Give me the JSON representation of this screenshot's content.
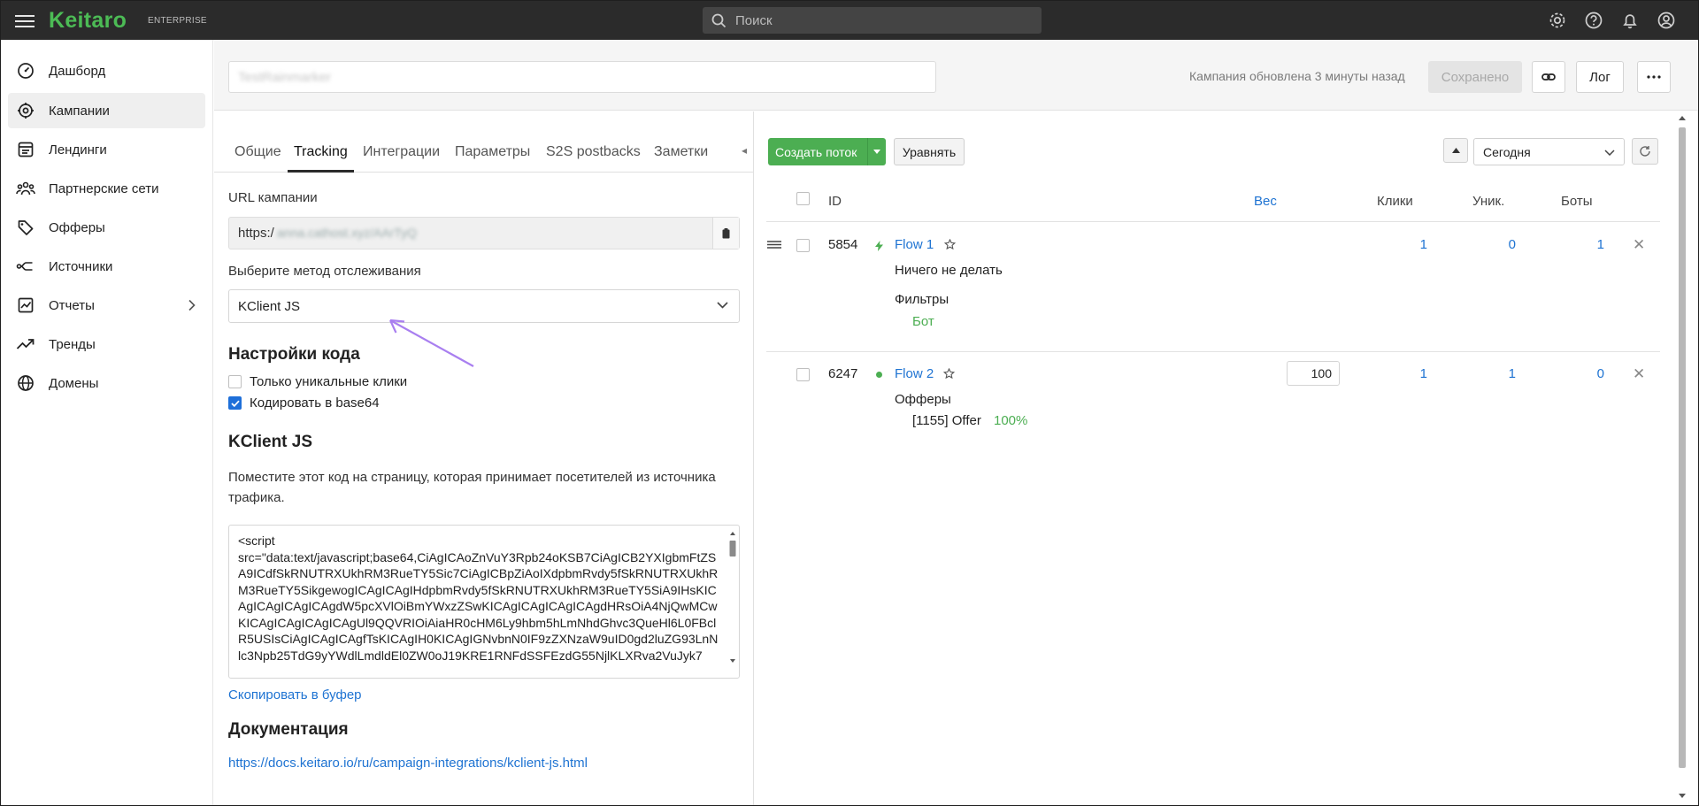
{
  "app": {
    "brand": "Keitaro",
    "edition": "ENTERPRISE",
    "search_placeholder": "Поиск",
    "icons": [
      "menu-icon",
      "search-icon",
      "settings-icon",
      "help-icon",
      "bell-icon",
      "user-icon"
    ]
  },
  "sidebar": {
    "items": [
      {
        "label": "Дашборд",
        "icon": "dashboard-icon"
      },
      {
        "label": "Кампании",
        "icon": "campaigns-icon",
        "active": true
      },
      {
        "label": "Лендинги",
        "icon": "landings-icon"
      },
      {
        "label": "Партнерские сети",
        "icon": "partners-icon"
      },
      {
        "label": "Офферы",
        "icon": "offers-icon"
      },
      {
        "label": "Источники",
        "icon": "sources-icon"
      },
      {
        "label": "Отчеты",
        "icon": "reports-icon"
      },
      {
        "label": "Тренды",
        "icon": "trends-icon"
      },
      {
        "label": "Домены",
        "icon": "domains-icon"
      }
    ]
  },
  "header": {
    "campaign_name": "TestRainmarker",
    "updated_text": "Кампания обновлена 3 минуты назад",
    "saved_label": "Сохранено",
    "log_label": "Лог"
  },
  "left": {
    "tabs": [
      "Общие",
      "Tracking",
      "Интеграции",
      "Параметры",
      "S2S postbacks",
      "Заметки"
    ],
    "active_tab": "Tracking",
    "url_label": "URL кампании",
    "url_prefix": "https:/",
    "url_rest": "anna.cathost.xyz/AArTyQ",
    "method_label": "Выберите метод отслеживания",
    "method_value": "KClient JS",
    "code_settings_title": "Настройки кода",
    "unique_clicks_label": "Только уникальные клики",
    "base64_label": "Кодировать в base64",
    "kclient_title": "KClient JS",
    "kclient_desc": "Поместите этот код на страницу, которая принимает посетителей из источника трафика.",
    "code": "<script\nsrc=\"data:text/javascript;base64,CiAgICAoZnVuY3Rpb24oKSB7CiAgICB2YXIgbmFtZSA9ICdfSkRNUTRXUkhRM3RueTY5Sic7CiAgICBpZiAoIXdpbmRvdy5fSkRNUTRXUkhRM3RueTY5SikgewogICAgICAgIHdpbmRvdy5fSkRNUTRXUkhRM3RueTY5SiA9IHsKICAgICAgICAgICAgdW5pcXVlOiBmYWxzZSwKICAgICAgICAgICAgdHRsOiA4NjQwMCwKICAgICAgICAgICAgUl9QQVRIOiAiaHR0cHM6Ly9hbm5hLmNhdGhvc3QueHl6L0FBclR5USIsCiAgICAgICAgfTsKICAgIH0KICAgIGNvbnN0IF9zZXNzaW9uID0gd2luZG93LnNlc3Npb25TdG9yYWdlLmdldEl0ZW0oJ19KRE1RNFdSSFEzdG55NjlKLXRva2VuJyk7",
    "copy_label": "Скопировать в буфер",
    "docs_title": "Документация",
    "docs_link": "https://docs.keitaro.io/ru/campaign-integrations/kclient-js.html"
  },
  "right": {
    "create_flow_label": "Создать поток",
    "align_label": "Уравнять",
    "date_value": "Сегодня",
    "columns": {
      "id": "ID",
      "weight": "Вес",
      "clicks": "Клики",
      "unique": "Уник.",
      "bots": "Боты"
    },
    "flows": [
      {
        "id": "5854",
        "name": "Flow 1",
        "action": "Ничего не делать",
        "section": "Фильтры",
        "detail": "Бот",
        "weight": "",
        "clicks": "1",
        "unique": "0",
        "bots": "1",
        "status_color": "#4cae52"
      },
      {
        "id": "6247",
        "name": "Flow 2",
        "action": "",
        "section": "Офферы",
        "detail": "[1155] Offer",
        "percent": "100%",
        "weight": "100",
        "clicks": "1",
        "unique": "1",
        "bots": "0",
        "status_color": "#4cae52"
      }
    ]
  }
}
